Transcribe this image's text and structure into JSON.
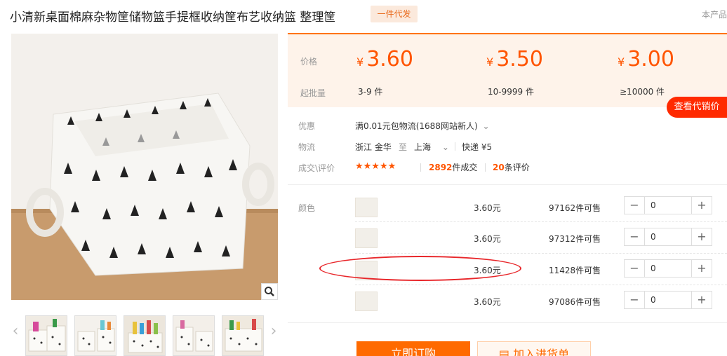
{
  "title": "小清新桌面棉麻杂物筐储物篮手提框收纳筐布艺收纳篮 整理筐",
  "badge": "一件代发",
  "corner_text": "本产品",
  "price_panel": {
    "price_label": "价格",
    "qty_label": "起批量",
    "tiers": [
      {
        "symbol": "¥",
        "price": "3.60",
        "qty": "3-9 件"
      },
      {
        "symbol": "¥",
        "price": "3.50",
        "qty": "10-9999 件"
      },
      {
        "symbol": "¥",
        "price": "3.00",
        "qty": "≥10000 件"
      }
    ],
    "consign_button": "查看代销价"
  },
  "info": {
    "promo_label": "优惠",
    "promo_value": "满0.01元包物流(1688网站新人)",
    "logistics_label": "物流",
    "from": "浙江 金华",
    "to_word": "至",
    "to": "上海",
    "express": "快递 ¥5",
    "trade_label": "成交\\评价",
    "stars": "★★★★★",
    "deals_count": "2892",
    "deals_suffix": "件成交",
    "reviews_count": "20",
    "reviews_suffix": "条评价"
  },
  "sku": {
    "color_label": "颜色",
    "rows": [
      {
        "price": "3.60元",
        "stock": "97162件可售",
        "qty": "0"
      },
      {
        "price": "3.60元",
        "stock": "97312件可售",
        "qty": "0"
      },
      {
        "price": "3.60元",
        "stock": "11428件可售",
        "qty": "0"
      },
      {
        "price": "3.60元",
        "stock": "97086件可售",
        "qty": "0"
      }
    ],
    "minus": "−",
    "plus": "+"
  },
  "actions": {
    "buy": "立即订购",
    "cart": "加入进货单"
  },
  "colors": {
    "accent": "#ff6a00",
    "price": "#ff5400",
    "highlight_ellipse": "#e8262a"
  }
}
